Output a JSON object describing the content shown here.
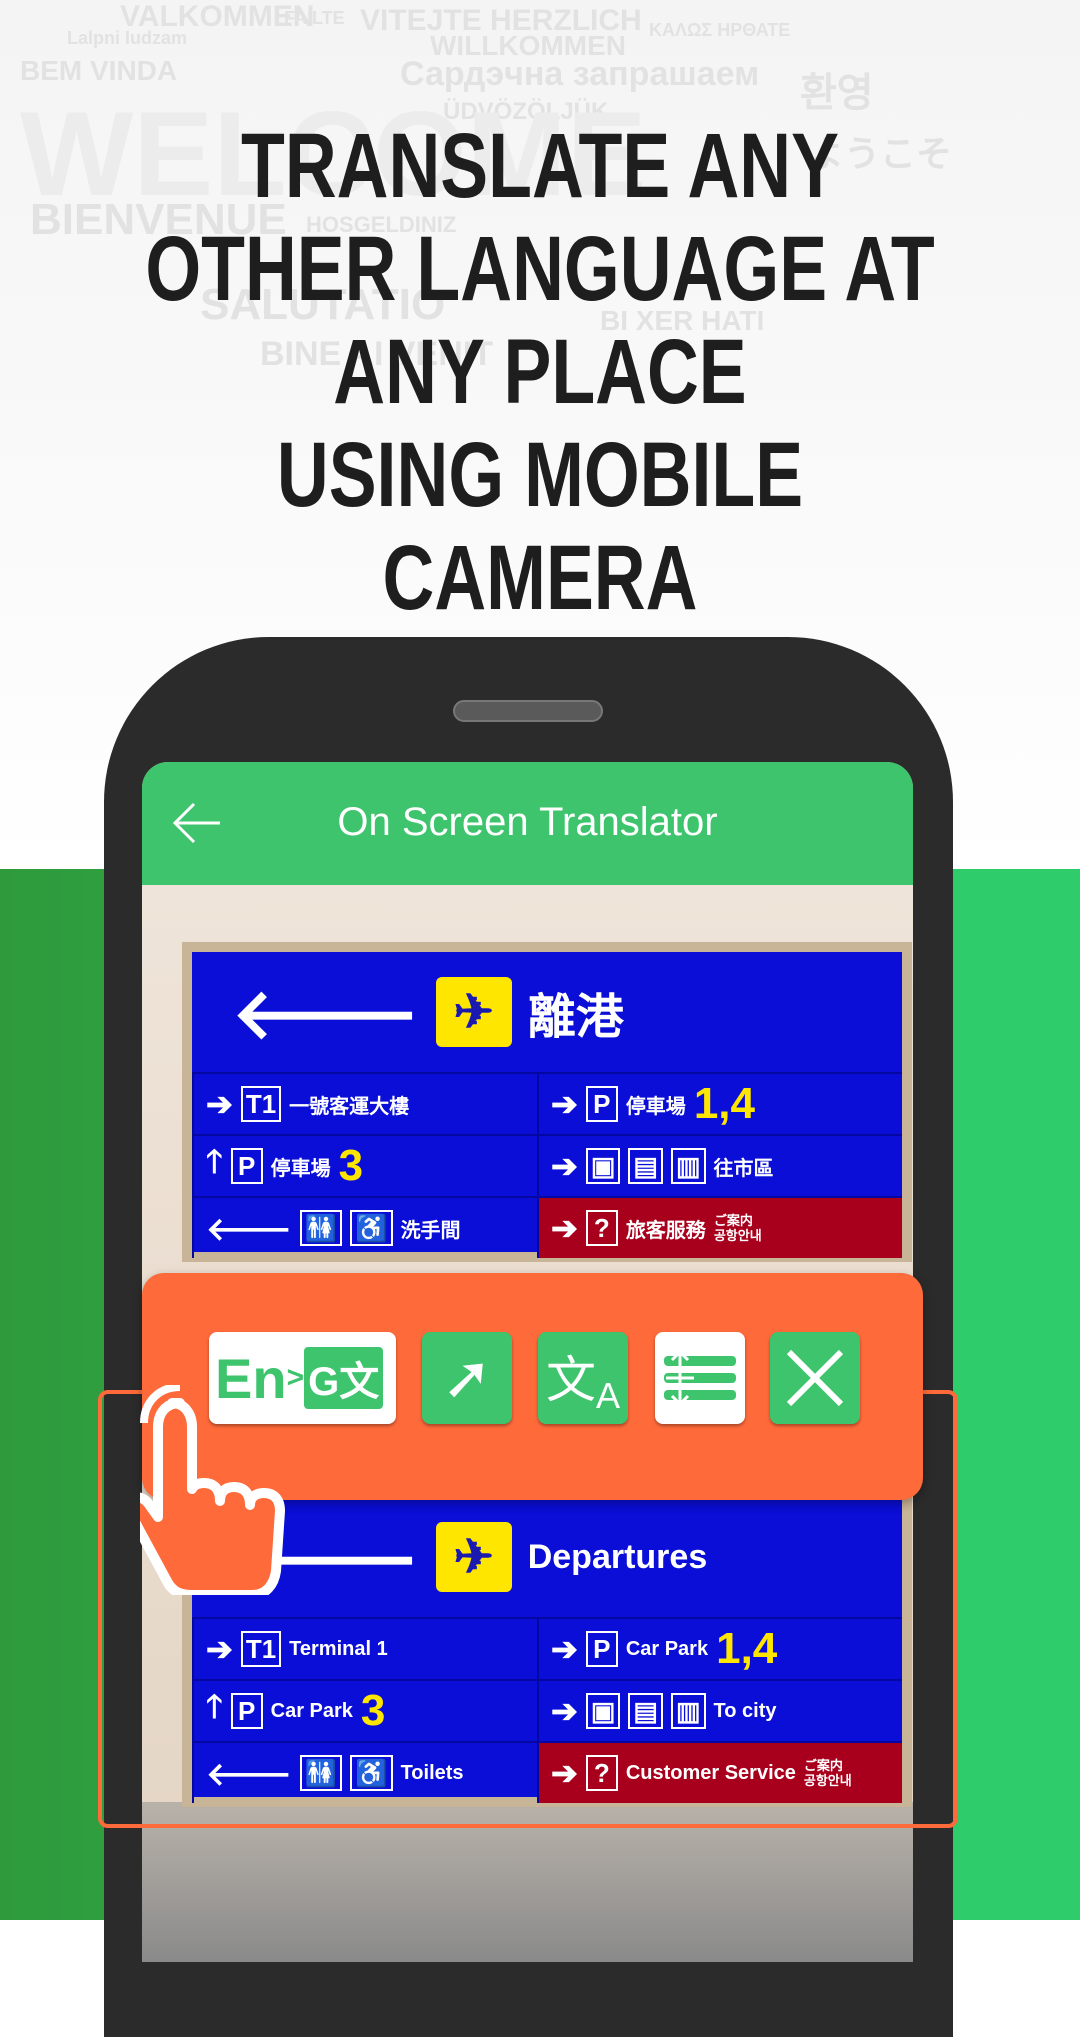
{
  "background_words": [
    "VALKOMMEN",
    "FAILTE",
    "VITEJTE HERZLICH",
    "WILLKOMMEN",
    "Lalpni Iudzam",
    "BEM VINDA",
    "Сардэчна запрашаем",
    "ÜDVÖZÖLJÜK",
    "歡迎",
    "환영",
    "ようこそ",
    "WELCOME",
    "BIENVENUE",
    "HOSGELDINIZ",
    "SALUTATIO",
    "BINE AI VENIT",
    "BI XER HATI",
    "ΚΑΛΩΣ ΗΡΘΑΤΕ"
  ],
  "headline": {
    "lines": [
      "TRANSLATE ANY",
      "OTHER LANGUAGE AT",
      "ANY PLACE",
      "USING MOBILE CAMERA"
    ]
  },
  "app": {
    "title": "On Screen Translator",
    "back_icon": "arrow-left-icon"
  },
  "sign_original": {
    "header": "離港",
    "cells": [
      {
        "box": "T1",
        "text": "一號客運大樓",
        "num": ""
      },
      {
        "box": "P",
        "text": "停車場",
        "num": "1,4"
      },
      {
        "box": "P",
        "text": "停車場",
        "num": "3"
      },
      {
        "box": "",
        "text": "往市區",
        "num": ""
      },
      {
        "box": "",
        "text": "洗手間",
        "num": ""
      },
      {
        "box": "?",
        "text": "旅客服務",
        "num": "",
        "extra": "ご案内 공항안내"
      }
    ]
  },
  "sign_translated": {
    "header": "Departures",
    "cells": [
      {
        "box": "T1",
        "text": "Terminal 1",
        "num": ""
      },
      {
        "box": "P",
        "text": "Car Park",
        "num": "1,4"
      },
      {
        "box": "P",
        "text": "Car Park",
        "num": "3"
      },
      {
        "box": "",
        "text": "To city",
        "num": ""
      },
      {
        "box": "",
        "text": "Toilets",
        "num": ""
      },
      {
        "box": "?",
        "text": "Customer Service",
        "num": "",
        "extra": "ご案内 공항안내"
      }
    ]
  },
  "toolbar": {
    "language_button": {
      "from": "En",
      "to": "G文"
    },
    "tools": [
      "tap-select-icon",
      "translate-icon",
      "resize-icon",
      "close-icon"
    ]
  },
  "colors": {
    "green": "#3ec46d",
    "orange": "#ff6a3a",
    "sign_blue": "#0a0ed6",
    "sign_red": "#a8001c",
    "phone": "#2b2b2b"
  }
}
